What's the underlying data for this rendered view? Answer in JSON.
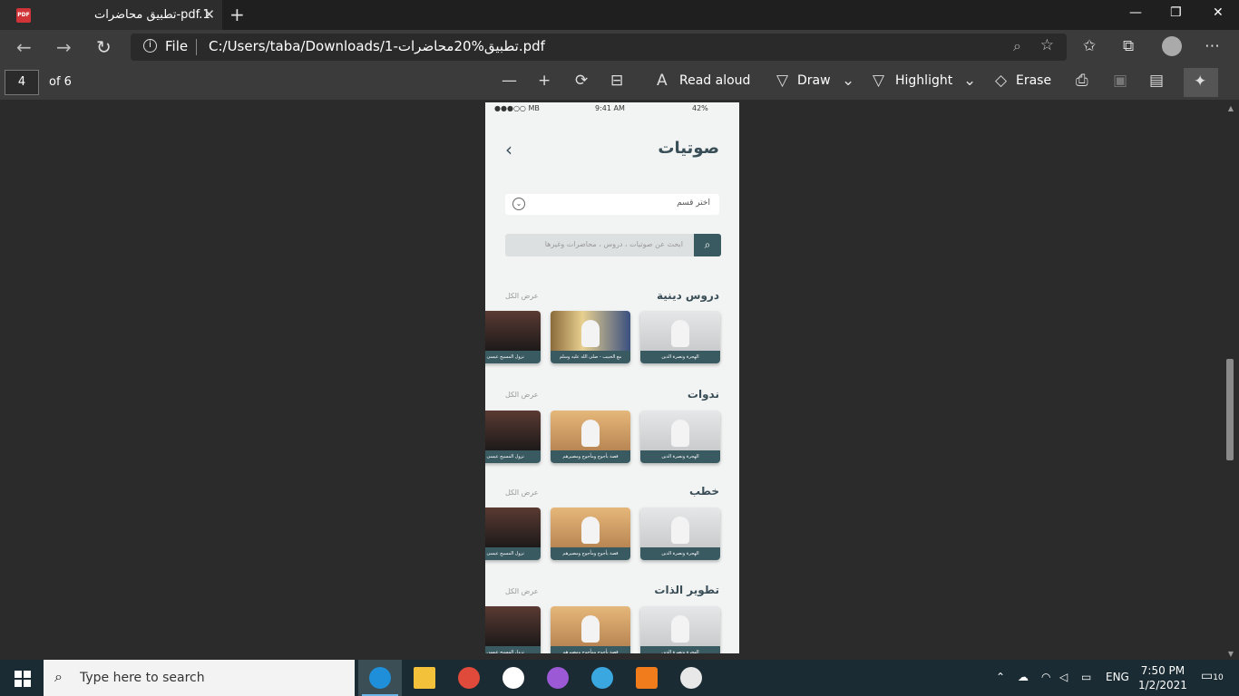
{
  "tab": {
    "title": "تطبيق محاضرات-pdf.1",
    "close": "✕"
  },
  "window": {
    "minimize": "—",
    "restore": "❐",
    "close": "✕"
  },
  "nav": {
    "back": "←",
    "forward": "→",
    "refresh": "↻"
  },
  "address": {
    "scheme": "File",
    "url": "C:/Users/taba/Downloads/1-تطبيق%20محاضرات.pdf"
  },
  "pdf_toolbar": {
    "page_current": "4",
    "page_total": "of 6",
    "read_aloud": "Read aloud",
    "draw": "Draw",
    "highlight": "Highlight",
    "erase": "Erase"
  },
  "app": {
    "status_left": "●●●○○ MB",
    "status_time": "9:41 AM",
    "status_right": "42%",
    "title": "صوتيات",
    "select_label": "اختر قسم",
    "search_placeholder": "ابحث عن صوتيات ، دروس ، محاضرات وغيرها",
    "show_all": "عرض الكل",
    "sections": [
      {
        "title": "دروس دينية",
        "cards": [
          "الهجرة ونصرة الدين",
          "مع الحبيب - صلى الله عليه وسلم",
          "نزول المسيح عيسى عليه"
        ]
      },
      {
        "title": "ندوات",
        "cards": [
          "الهجرة ونصرة الدين",
          "قصة يأجوج ومأجوج ومصيرهم",
          "نزول المسيح عيسى عليه"
        ]
      },
      {
        "title": "خطب",
        "cards": [
          "الهجرة ونصرة الدين",
          "قصة يأجوج ومأجوج ومصيرهم",
          "نزول المسيح عيسى عليه"
        ]
      },
      {
        "title": "تطوير الذات",
        "cards": [
          "الهجرة ونصرة الدين",
          "قصة يأجوج ومأجوج ومصيرهم",
          "نزول المسيح عيسى عليه"
        ]
      }
    ]
  },
  "taskbar": {
    "search_placeholder": "Type here to search",
    "lang": "ENG",
    "time": "7:50 PM",
    "date": "1/2/2021",
    "notifications": "10"
  }
}
